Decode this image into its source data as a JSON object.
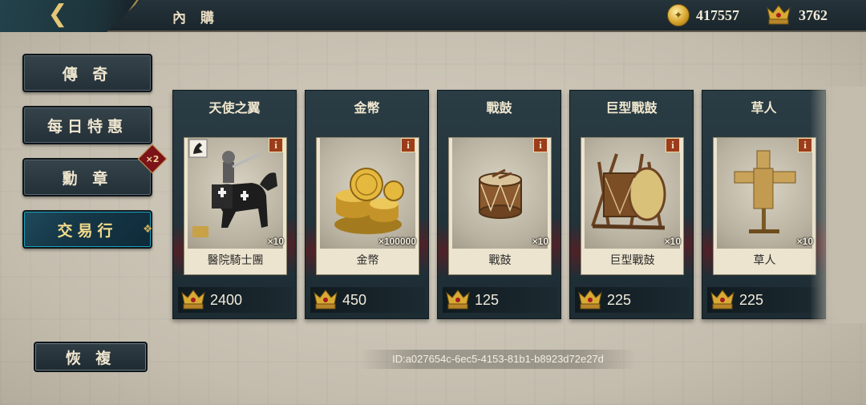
{
  "header": {
    "back_icon": "back-arrow-icon",
    "title": "內 購",
    "gold_amount": "417557",
    "crown_amount": "3762",
    "gold_icon": "gold-coin-icon",
    "crown_icon": "crown-currency-icon"
  },
  "sidebar": {
    "items": [
      {
        "label": "傳 奇",
        "active": false
      },
      {
        "label": "每日特惠",
        "active": false
      },
      {
        "label": "勳 章",
        "active": false,
        "badge": "×2"
      },
      {
        "label": "交易行",
        "active": true
      }
    ],
    "restore_label": "恢 複"
  },
  "cards": [
    {
      "title": "天使之翼",
      "item_name": "醫院騎士團",
      "quantity": "×10",
      "price": "2400",
      "art": "knight-icon"
    },
    {
      "title": "金幣",
      "item_name": "金幣",
      "quantity": "×100000",
      "price": "450",
      "art": "gold-coins-icon"
    },
    {
      "title": "戰鼓",
      "item_name": "戰鼓",
      "quantity": "×10",
      "price": "125",
      "art": "drum-icon"
    },
    {
      "title": "巨型戰鼓",
      "item_name": "巨型戰鼓",
      "quantity": "×10",
      "price": "225",
      "art": "giant-drum-icon"
    },
    {
      "title": "草人",
      "item_name": "草人",
      "quantity": "×10",
      "price": "225",
      "art": "scarecrow-icon"
    }
  ],
  "info_label": "i",
  "footer": {
    "id_text": "ID:a027654c-6ec5-4153-81b1-b8923d72e27d"
  },
  "colors": {
    "accent_gold": "#e4c776",
    "active_tab": "#1aa0bd",
    "panel": "#2a3c44"
  }
}
